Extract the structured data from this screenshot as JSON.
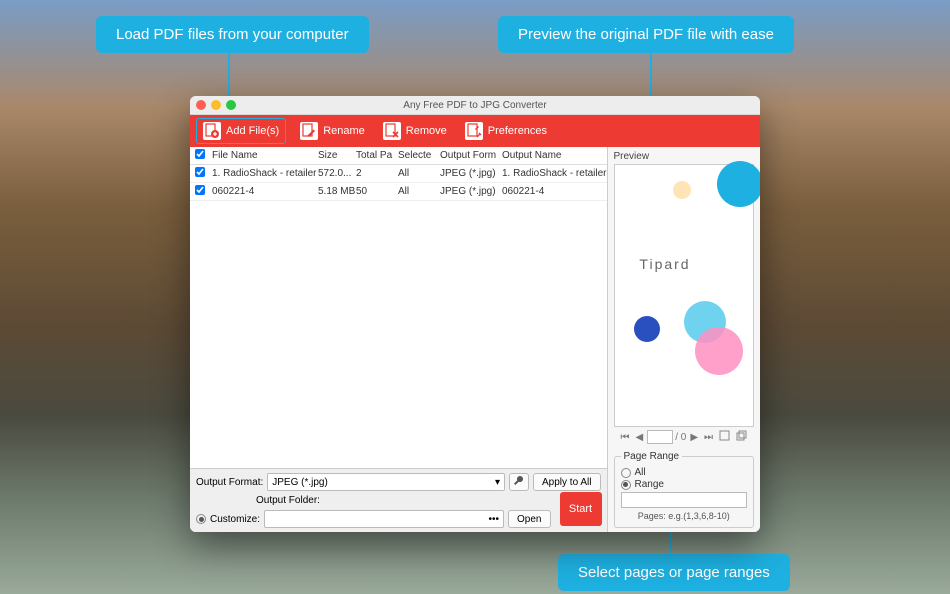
{
  "accent": "#1eb0e0",
  "callouts": {
    "load": "Load PDF files from your computer",
    "preview": "Preview the original PDF file with ease",
    "range": "Select pages or page ranges"
  },
  "window": {
    "title": "Any Free PDF to JPG Converter"
  },
  "toolbar": {
    "add": "Add File(s)",
    "rename": "Rename",
    "remove": "Remove",
    "prefs": "Preferences"
  },
  "table": {
    "headers": {
      "filename": "File Name",
      "size": "Size",
      "totalPages": "Total Pa",
      "selected": "Selecte",
      "outputFormat": "Output Form",
      "outputName": "Output Name"
    },
    "rows": [
      {
        "checked": true,
        "name": "1. RadioShack - retailer",
        "size": "572.0...",
        "pages": "2",
        "selected": "All",
        "format": "JPEG (*.jpg)",
        "outname": "1. RadioShack - retailer"
      },
      {
        "checked": true,
        "name": "060221-4",
        "size": "5.18 MB",
        "pages": "50",
        "selected": "All",
        "format": "JPEG (*.jpg)",
        "outname": "060221-4"
      }
    ]
  },
  "bottom": {
    "outputFormatLabel": "Output Format:",
    "outputFormatValue": "JPEG (*.jpg)",
    "applyAll": "Apply to All",
    "outputFolderLabel": "Output Folder:",
    "customize": "Customize:",
    "open": "Open",
    "start": "Start"
  },
  "preview": {
    "label": "Preview",
    "brand": "Tipard",
    "pageSep": "/ 0"
  },
  "pageRange": {
    "legend": "Page Range",
    "all": "All",
    "range": "Range",
    "selected": "range",
    "hint": "Pages: e.g.(1,3,6,8-10)"
  }
}
